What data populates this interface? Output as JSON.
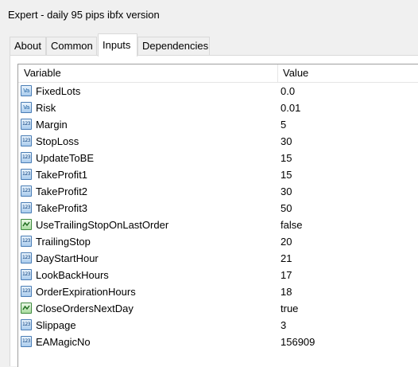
{
  "window": {
    "title": "Expert - daily 95 pips ibfx version"
  },
  "tabs": [
    {
      "label": "About",
      "active": false
    },
    {
      "label": "Common",
      "active": false
    },
    {
      "label": "Inputs",
      "active": true
    },
    {
      "label": "Dependencies",
      "active": false
    }
  ],
  "table": {
    "columns": [
      "Variable",
      "Value"
    ],
    "rows": [
      {
        "name": "FixedLots",
        "value": "0.0",
        "type_icon": "double-type-icon"
      },
      {
        "name": "Risk",
        "value": "0.01",
        "type_icon": "double-type-icon"
      },
      {
        "name": "Margin",
        "value": "5",
        "type_icon": "integer-type-icon"
      },
      {
        "name": "StopLoss",
        "value": "30",
        "type_icon": "integer-type-icon"
      },
      {
        "name": "UpdateToBE",
        "value": "15",
        "type_icon": "integer-type-icon"
      },
      {
        "name": "TakeProfit1",
        "value": "15",
        "type_icon": "integer-type-icon"
      },
      {
        "name": "TakeProfit2",
        "value": "30",
        "type_icon": "integer-type-icon"
      },
      {
        "name": "TakeProfit3",
        "value": "50",
        "type_icon": "integer-type-icon"
      },
      {
        "name": "UseTrailingStopOnLastOrder",
        "value": "false",
        "type_icon": "boolean-type-icon"
      },
      {
        "name": "TrailingStop",
        "value": "20",
        "type_icon": "integer-type-icon"
      },
      {
        "name": "DayStartHour",
        "value": "21",
        "type_icon": "integer-type-icon"
      },
      {
        "name": "LookBackHours",
        "value": "17",
        "type_icon": "integer-type-icon"
      },
      {
        "name": "OrderExpirationHours",
        "value": "18",
        "type_icon": "integer-type-icon"
      },
      {
        "name": "CloseOrdersNextDay",
        "value": "true",
        "type_icon": "boolean-type-icon"
      },
      {
        "name": "Slippage",
        "value": "3",
        "type_icon": "integer-type-icon"
      },
      {
        "name": "EAMagicNo",
        "value": "156909",
        "type_icon": "integer-type-icon"
      }
    ]
  }
}
